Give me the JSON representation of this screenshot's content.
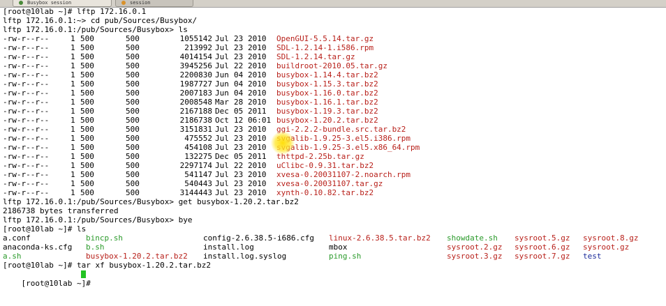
{
  "tabs": [
    {
      "label": "Busybox session",
      "dot": "#4a8a3a"
    },
    {
      "label": "session",
      "dot": "#d9912a"
    }
  ],
  "session": {
    "cmd1": "[root@10lab ~]# lftp 172.16.0.1",
    "cmd2": "lftp 172.16.0.1:~> cd pub/Sources/Busybox/",
    "cmd3": "lftp 172.16.0.1:/pub/Sources/Busybox> ls",
    "files": [
      {
        "perm": "-rw-r--r--",
        "links": "1",
        "owner": "500",
        "group": "500",
        "size": "1055142",
        "month": "Jul",
        "day": "23",
        "year": "2010",
        "name": "OpenGUI-5.5.14.tar.gz"
      },
      {
        "perm": "-rw-r--r--",
        "links": "1",
        "owner": "500",
        "group": "500",
        "size": "213992",
        "month": "Jul",
        "day": "23",
        "year": "2010",
        "name": "SDL-1.2.14-1.i586.rpm"
      },
      {
        "perm": "-rw-r--r--",
        "links": "1",
        "owner": "500",
        "group": "500",
        "size": "4014154",
        "month": "Jul",
        "day": "23",
        "year": "2010",
        "name": "SDL-1.2.14.tar.gz"
      },
      {
        "perm": "-rw-r--r--",
        "links": "1",
        "owner": "500",
        "group": "500",
        "size": "3945256",
        "month": "Jul",
        "day": "22",
        "year": "2010",
        "name": "buildroot-2010.05.tar.gz"
      },
      {
        "perm": "-rw-r--r--",
        "links": "1",
        "owner": "500",
        "group": "500",
        "size": "2200830",
        "month": "Jun",
        "day": "04",
        "year": "2010",
        "name": "busybox-1.14.4.tar.bz2"
      },
      {
        "perm": "-rw-r--r--",
        "links": "1",
        "owner": "500",
        "group": "500",
        "size": "1987727",
        "month": "Jun",
        "day": "04",
        "year": "2010",
        "name": "busybox-1.15.3.tar.bz2"
      },
      {
        "perm": "-rw-r--r--",
        "links": "1",
        "owner": "500",
        "group": "500",
        "size": "2007183",
        "month": "Jun",
        "day": "04",
        "year": "2010",
        "name": "busybox-1.16.0.tar.bz2"
      },
      {
        "perm": "-rw-r--r--",
        "links": "1",
        "owner": "500",
        "group": "500",
        "size": "2008548",
        "month": "Mar",
        "day": "28",
        "year": "2010",
        "name": "busybox-1.16.1.tar.bz2"
      },
      {
        "perm": "-rw-r--r--",
        "links": "1",
        "owner": "500",
        "group": "500",
        "size": "2167188",
        "month": "Dec",
        "day": "05",
        "year": "2011",
        "name": "busybox-1.19.3.tar.bz2"
      },
      {
        "perm": "-rw-r--r--",
        "links": "1",
        "owner": "500",
        "group": "500",
        "size": "2186738",
        "month": "Oct",
        "day": "12",
        "year": "06:01",
        "name": "busybox-1.20.2.tar.bz2"
      },
      {
        "perm": "-rw-r--r--",
        "links": "1",
        "owner": "500",
        "group": "500",
        "size": "3151831",
        "month": "Jul",
        "day": "23",
        "year": "2010",
        "name": "ggi-2.2.2-bundle.src.tar.bz2"
      },
      {
        "perm": "-rw-r--r--",
        "links": "1",
        "owner": "500",
        "group": "500",
        "size": "475552",
        "month": "Jul",
        "day": "23",
        "year": "2010",
        "name": "svgalib-1.9.25-3.el5.i386.rpm"
      },
      {
        "perm": "-rw-r--r--",
        "links": "1",
        "owner": "500",
        "group": "500",
        "size": "454108",
        "month": "Jul",
        "day": "23",
        "year": "2010",
        "name": "svgalib-1.9.25-3.el5.x86_64.rpm"
      },
      {
        "perm": "-rw-r--r--",
        "links": "1",
        "owner": "500",
        "group": "500",
        "size": "132275",
        "month": "Dec",
        "day": "05",
        "year": "2011",
        "name": "thttpd-2.25b.tar.gz"
      },
      {
        "perm": "-rw-r--r--",
        "links": "1",
        "owner": "500",
        "group": "500",
        "size": "2297174",
        "month": "Jul",
        "day": "22",
        "year": "2010",
        "name": "uClibc-0.9.31.tar.bz2"
      },
      {
        "perm": "-rw-r--r--",
        "links": "1",
        "owner": "500",
        "group": "500",
        "size": "541147",
        "month": "Jul",
        "day": "23",
        "year": "2010",
        "name": "xvesa-0.20031107-2.noarch.rpm"
      },
      {
        "perm": "-rw-r--r--",
        "links": "1",
        "owner": "500",
        "group": "500",
        "size": "540443",
        "month": "Jul",
        "day": "23",
        "year": "2010",
        "name": "xvesa-0.20031107.tar.gz"
      },
      {
        "perm": "-rw-r--r--",
        "links": "1",
        "owner": "500",
        "group": "500",
        "size": "3144443",
        "month": "Jul",
        "day": "23",
        "year": "2010",
        "name": "xynth-0.10.82.tar.bz2"
      }
    ],
    "cmd4": "lftp 172.16.0.1:/pub/Sources/Busybox> get busybox-1.20.2.tar.bz2",
    "transfer": "2186738 bytes transferred",
    "cmd5": "lftp 172.16.0.1:/pub/Sources/Busybox> bye",
    "cmd6": "[root@10lab ~]# ls",
    "ls_rows": [
      [
        {
          "name": "a.conf",
          "color": "black"
        },
        {
          "name": "bincp.sh",
          "color": "green"
        },
        {
          "name": "config-2.6.38.5-i686.cfg",
          "color": "black"
        },
        {
          "name": "linux-2.6.38.5.tar.bz2",
          "color": "red"
        },
        {
          "name": "showdate.sh",
          "color": "green"
        },
        {
          "name": "sysroot.5.gz",
          "color": "red"
        },
        {
          "name": "sysroot.8.gz",
          "color": "red"
        }
      ],
      [
        {
          "name": "anaconda-ks.cfg",
          "color": "black"
        },
        {
          "name": "b.sh",
          "color": "green"
        },
        {
          "name": "install.log",
          "color": "black"
        },
        {
          "name": "mbox",
          "color": "black"
        },
        {
          "name": "",
          "color": "black"
        },
        {
          "name": "sysroot.2.gz",
          "color": "red"
        },
        {
          "name": "sysroot.6.gz",
          "color": "red"
        },
        {
          "name": "sysroot.gz",
          "color": "red"
        }
      ],
      [
        {
          "name": "a.sh",
          "color": "green"
        },
        {
          "name": "busybox-1.20.2.tar.bz2",
          "color": "red"
        },
        {
          "name": "install.log.syslog",
          "color": "black"
        },
        {
          "name": "ping.sh",
          "color": "green"
        },
        {
          "name": "",
          "color": "black"
        },
        {
          "name": "sysroot.3.gz",
          "color": "red"
        },
        {
          "name": "sysroot.7.gz",
          "color": "red"
        },
        {
          "name": "test",
          "color": "navy"
        }
      ]
    ],
    "cmd7": "[root@10lab ~]# tar xf busybox-1.20.2.tar.bz2",
    "prompt": "[root@10lab ~]# "
  }
}
